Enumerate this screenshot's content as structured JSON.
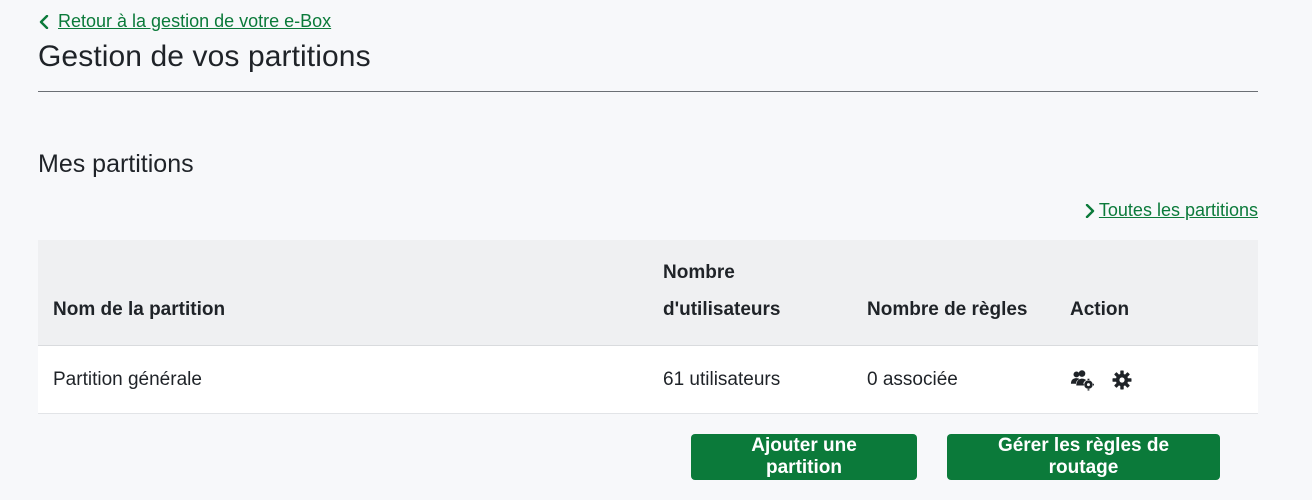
{
  "nav": {
    "back_label": "Retour à la gestion de votre e-Box"
  },
  "page": {
    "title": "Gestion de vos partitions"
  },
  "section": {
    "title": "Mes partitions",
    "all_link_label": "Toutes les partitions"
  },
  "table": {
    "headers": {
      "name": "Nom de la partition",
      "users": "Nombre d'utilisateurs",
      "rules": "Nombre de règles",
      "action": "Action"
    },
    "rows": [
      {
        "name": "Partition générale",
        "users": "61 utilisateurs",
        "rules": "0 associée",
        "actions": [
          "users-gear-icon",
          "gear-icon"
        ]
      }
    ]
  },
  "buttons": {
    "add_partition": "Ajouter une partition",
    "manage_routing": "Gérer les règles de routage"
  },
  "colors": {
    "accent": "#0b7a3a",
    "background": "#f7f8fa",
    "table_header": "#eff0f2"
  }
}
